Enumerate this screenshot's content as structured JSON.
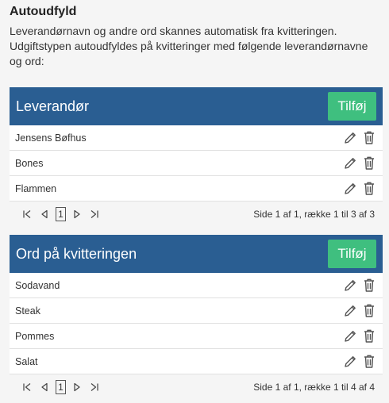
{
  "autofill": {
    "title": "Autoudfyld",
    "description": "Leverandørnavn og andre ord skannes automatisk fra kvitteringen. Udgiftstypen autoudfyldes på kvitteringer med følgende leverandørnavne og ord:"
  },
  "suppliers": {
    "title": "Leverandør",
    "add_label": "Tilføj",
    "items": [
      {
        "label": "Jensens Bøfhus"
      },
      {
        "label": "Bones"
      },
      {
        "label": "Flammen"
      }
    ],
    "pager": {
      "page": "1",
      "info": "Side 1 af 1, række 1 til 3 af 3"
    }
  },
  "words": {
    "title": "Ord på kvitteringen",
    "add_label": "Tilføj",
    "items": [
      {
        "label": "Sodavand"
      },
      {
        "label": "Steak"
      },
      {
        "label": "Pommes"
      },
      {
        "label": "Salat"
      }
    ],
    "pager": {
      "page": "1",
      "info": "Side 1 af 1, række 1 til 4 af 4"
    }
  },
  "icons": {
    "edit": "pencil-icon",
    "delete": "trash-icon",
    "first": "first-page-icon",
    "prev": "prev-page-icon",
    "next": "next-page-icon",
    "last": "last-page-icon"
  },
  "colors": {
    "header": "#2a5e92",
    "add_button": "#3fbf7f"
  }
}
